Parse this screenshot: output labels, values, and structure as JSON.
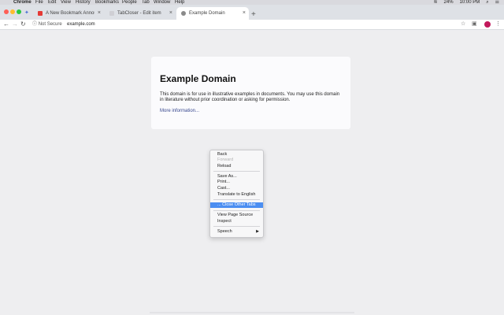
{
  "menubar": {
    "app": "Chrome",
    "items": [
      "File",
      "Edit",
      "View",
      "History",
      "Bookmarks",
      "People",
      "Tab",
      "Window",
      "Help"
    ],
    "battery": "24%",
    "time": "10:00 PM"
  },
  "tabs": [
    {
      "title": "A New Bookmark Announcement",
      "favicon_color": "#e53935"
    },
    {
      "title": "TabCloser - Edit item",
      "favicon_color": "#cfcfd4"
    },
    {
      "title": "Example Domain",
      "favicon_color": "#8a8a8a"
    }
  ],
  "toolbar": {
    "security_label": "Not Secure",
    "url": "example.com"
  },
  "page": {
    "title": "Example Domain",
    "description": "This domain is for use in illustrative examples in documents. You may use this domain in literature without prior coordination or asking for permission.",
    "link": "More information..."
  },
  "context_menu": {
    "items": [
      {
        "label": "Back",
        "disabled": false
      },
      {
        "label": "Forward",
        "disabled": true
      },
      {
        "label": "Reload",
        "disabled": false
      },
      {
        "label": "Save As...",
        "disabled": false
      },
      {
        "label": "Print...",
        "disabled": false
      },
      {
        "label": "Cast...",
        "disabled": false
      },
      {
        "label": "Translate to English",
        "disabled": false
      },
      {
        "label": "... Close Other Tabs",
        "highlighted": true
      },
      {
        "label": "View Page Source",
        "disabled": false
      },
      {
        "label": "Inspect",
        "disabled": false
      },
      {
        "label": "Speech",
        "submenu": true
      }
    ]
  },
  "colors": {
    "highlight": "#4b8ef1",
    "link": "#38488f",
    "close_dot": "#fe5f57",
    "minimize_dot": "#febc2e",
    "zoom_dot": "#28c840"
  }
}
